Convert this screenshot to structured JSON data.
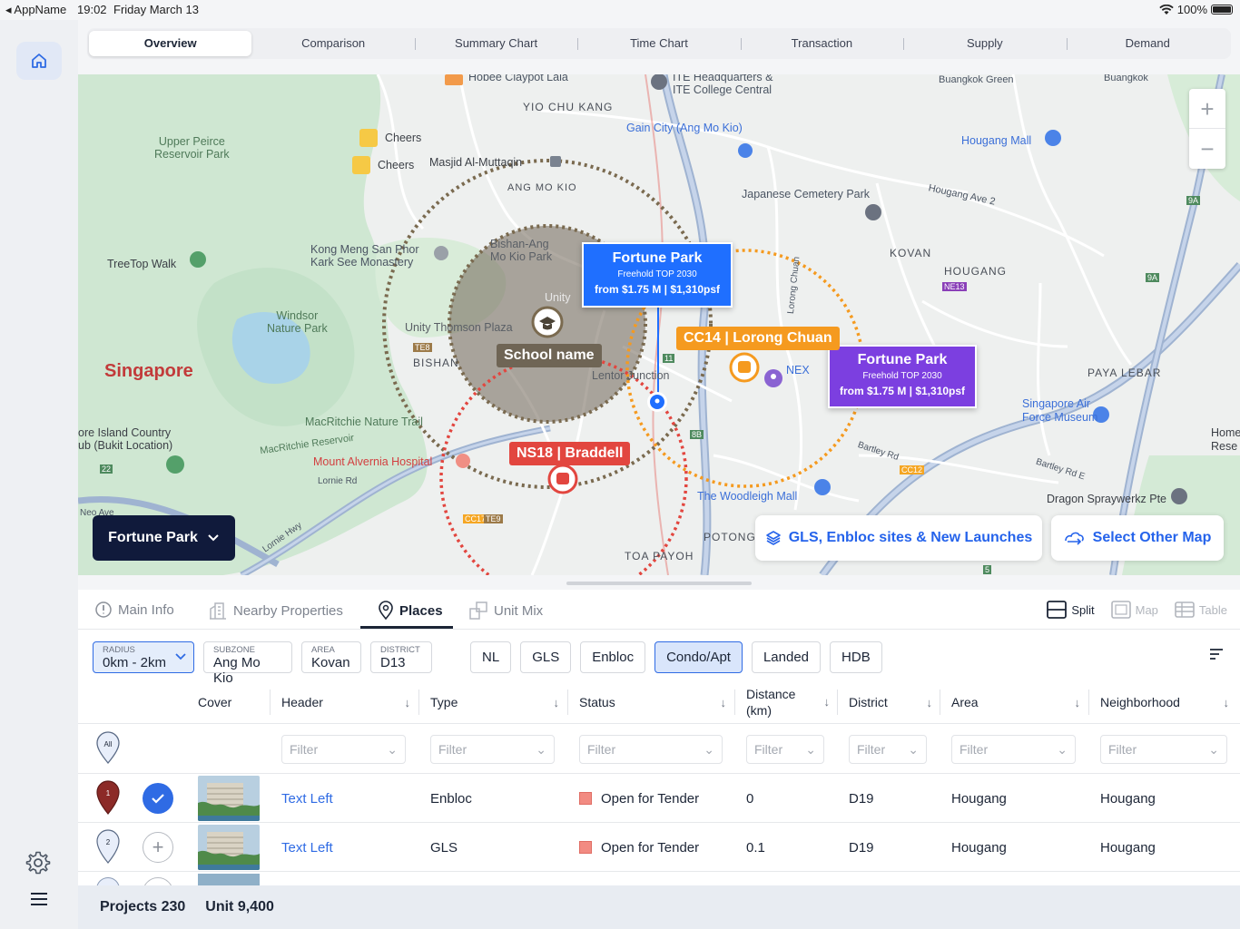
{
  "status_bar": {
    "back_app": "◂ AppName",
    "time": "19:02",
    "date": "Friday March 13",
    "battery": "100%"
  },
  "tabs": [
    {
      "label": "Overview",
      "active": true
    },
    {
      "label": "Comparison"
    },
    {
      "label": "Summary Chart"
    },
    {
      "label": "Time Chart"
    },
    {
      "label": "Transaction"
    },
    {
      "label": "Supply"
    },
    {
      "label": "Demand"
    }
  ],
  "map": {
    "labels": {
      "hobee": "Hobee Claypot Lala",
      "ite": "ITE Headquarters &\nITE College Central",
      "buangkok_green": "Buangkok Green",
      "buangkok": "Buangkok",
      "yio_chu_kang": "YIO CHU KANG",
      "gain_city": "Gain City (Ang Mo Kio)",
      "hougang_mall": "Hougang Mall",
      "upper_peirce": "Upper Peirce\nReservoir Park",
      "cheers1": "Cheers",
      "cheers2": "Cheers",
      "masjid": "Masjid Al-Muttaqin",
      "ang_mo_kio": "ANG MO KIO",
      "japanese_cemetery": "Japanese Cemetery Park",
      "hougang_ave2": "Hougang Ave 2",
      "kovan": "KOVAN",
      "hougang": "HOUGANG",
      "kong_meng": "Kong Meng San Phor\nKark See Monastery",
      "bishan_amk": "Bishan-Ang\nMo Kio Park",
      "treetop": "TreeTop Walk",
      "unity": "Unity",
      "unity_thomson": "Unity Thomson Plaza",
      "windsor": "Windsor\nNature Park",
      "singapore": "Singapore",
      "bishan": "BISHAN",
      "lentor": "Lentor Junction",
      "paya_lebar": "PAYA LEBAR",
      "nex": "NEX",
      "sg_air_force": "Singapore Air\nForce Museum",
      "macritchie_trail": "MacRitchie Nature Trail",
      "macritchie_res": "MacRitchie Reservoir",
      "island_country": "ore Island Country\nub (Bukit Location)",
      "mount_alvernia": "Mount Alvernia Hospital",
      "lornie_rd": "Lornie Rd",
      "bartley_rd": "Bartley Rd",
      "bartley_rd_e": "Bartley Rd E",
      "woodleigh": "The Woodleigh Mall",
      "dragon": "Dragon Spraywerkz Pte",
      "home": "Home\nRese",
      "potong": "POTONG",
      "toa_payoh": "TOA PAYOH",
      "lorong_chuan": "Lorong Chuan",
      "lornie_hwy": "Lornie Hwy",
      "neo_ave": "Neo Ave",
      "ne13": "NE13",
      "te8": "TE8",
      "cc12": "CC12",
      "cc17": "CC17",
      "te9": "TE9",
      "num_22": "22",
      "num_11": "11",
      "num_8b": "8B",
      "num_9a_1": "9A",
      "num_9a_2": "9A",
      "num_5": "5"
    },
    "school_label": "School name",
    "callout_blue": {
      "title": "Fortune Park",
      "sub": "Freehold TOP 2030",
      "price": "from $1.75 M | $1,310psf",
      "color": "#1f6fff"
    },
    "callout_purple": {
      "title": "Fortune Park",
      "sub": "Freehold TOP 2030",
      "price": "from $1.75 M | $1,310psf",
      "color": "#7c3fe0"
    },
    "cc14": {
      "label": "CC14 | Lorong Chuan",
      "color": "#f59a1f"
    },
    "ns18": {
      "label": "NS18 | Braddell",
      "color": "#e2463f"
    },
    "project_selector": "Fortune Park",
    "gls_button": "GLS, Enbloc sites & New Launches",
    "other_map_button": "Select Other Map"
  },
  "panel": {
    "subtabs": [
      {
        "label": "Main Info",
        "icon": "info-icon"
      },
      {
        "label": "Nearby Properties",
        "icon": "buildings-icon"
      },
      {
        "label": "Places",
        "icon": "place-pin-icon",
        "active": true
      },
      {
        "label": "Unit Mix",
        "icon": "unit-mix-icon"
      }
    ],
    "views": [
      {
        "label": "Split",
        "active": true
      },
      {
        "label": "Map"
      },
      {
        "label": "Table"
      }
    ],
    "filters": {
      "radius": {
        "key": "RADIUS",
        "value": "0km - 2km"
      },
      "subzone": {
        "key": "SUBZONE",
        "value": "Ang Mo Kio"
      },
      "area": {
        "key": "AREA",
        "value": "Kovan"
      },
      "district": {
        "key": "DISTRICT",
        "value": "D13"
      }
    },
    "chips": [
      {
        "label": "NL"
      },
      {
        "label": "GLS"
      },
      {
        "label": "Enbloc"
      },
      {
        "label": "Condo/Apt",
        "selected": true
      },
      {
        "label": "Landed"
      },
      {
        "label": "HDB"
      }
    ],
    "columns": [
      "Cover",
      "Header",
      "Type",
      "Status",
      "Distance\n(km)",
      "District",
      "Area",
      "Neighborhood"
    ],
    "filter_placeholder": "Filter",
    "all_label": "All",
    "rows": [
      {
        "pin": "1",
        "selected": true,
        "header": "Text Left",
        "type": "Enbloc",
        "status": "Open for Tender",
        "distance": "0",
        "district": "D19",
        "area": "Hougang",
        "neighborhood": "Hougang"
      },
      {
        "pin": "2",
        "selected": false,
        "header": "Text Left",
        "type": "GLS",
        "status": "Open for Tender",
        "distance": "0.1",
        "district": "D19",
        "area": "Hougang",
        "neighborhood": "Hougang"
      }
    ]
  },
  "footer": {
    "projects": "Projects 230",
    "units": "Unit 9,400"
  }
}
